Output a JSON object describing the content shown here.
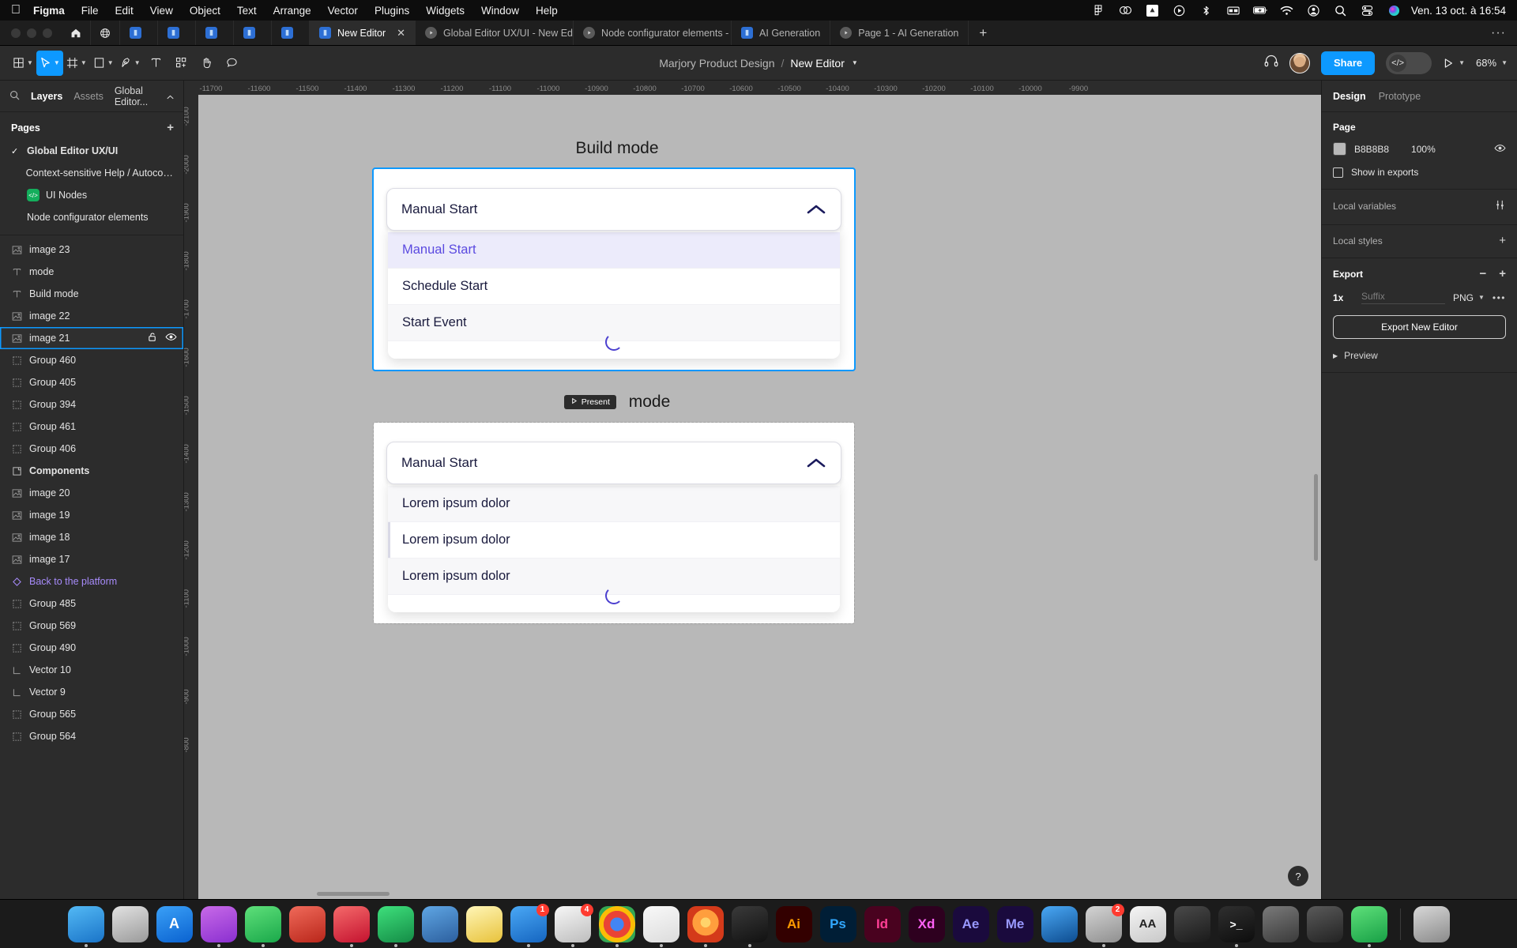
{
  "menubar": {
    "apple_icon": "apple-logo-icon",
    "items": [
      "Figma",
      "File",
      "Edit",
      "View",
      "Object",
      "Text",
      "Arrange",
      "Vector",
      "Plugins",
      "Widgets",
      "Window",
      "Help"
    ],
    "tray_icons": [
      "figma-menu-icon",
      "creative-cloud-icon",
      "dropbox-icon",
      "screen-record-icon",
      "bluetooth-icon",
      "display-icon",
      "battery-charging-icon",
      "wifi-icon",
      "control-center-account-icon",
      "search-icon",
      "control-center-icon",
      "siri-icon"
    ],
    "clock": "Ven. 13 oct. à 16:54"
  },
  "tabbar": {
    "home_icon": "home-icon",
    "globe_icon": "globe-icon",
    "tabs": [
      {
        "label": "",
        "icon": "figma-file-icon",
        "active": false
      },
      {
        "label": "",
        "icon": "figma-file-icon",
        "active": false
      },
      {
        "label": "",
        "icon": "figma-file-icon",
        "active": false
      },
      {
        "label": "",
        "icon": "figma-file-icon",
        "active": false
      },
      {
        "label": "",
        "icon": "figma-file-icon",
        "active": false
      },
      {
        "label": "New Editor",
        "icon": "figma-file-icon",
        "active": true
      },
      {
        "label": "Global Editor UX/UI - New Editor",
        "icon": "present-icon",
        "active": false
      },
      {
        "label": "Node configurator elements - New E",
        "icon": "present-icon",
        "active": false
      },
      {
        "label": "AI Generation",
        "icon": "figma-file-icon",
        "active": false
      },
      {
        "label": "Page 1 - AI Generation",
        "icon": "present-icon",
        "active": false
      }
    ],
    "new_tab_label": "+",
    "overflow_label": "···"
  },
  "toolbar": {
    "tools": [
      {
        "name": "main-menu-tool",
        "icon": "figma-logo-icon",
        "caret": true,
        "active": false
      },
      {
        "name": "move-tool",
        "icon": "cursor-icon",
        "caret": true,
        "active": true
      },
      {
        "name": "frame-tool",
        "icon": "frame-icon",
        "caret": true,
        "active": false
      },
      {
        "name": "shape-tool",
        "icon": "rectangle-icon",
        "caret": true,
        "active": false
      },
      {
        "name": "pen-tool",
        "icon": "pen-icon",
        "caret": true,
        "active": false
      },
      {
        "name": "text-tool",
        "icon": "text-icon",
        "caret": false,
        "active": false
      },
      {
        "name": "resources-tool",
        "icon": "components-plus-icon",
        "caret": false,
        "active": false
      },
      {
        "name": "hand-tool",
        "icon": "hand-icon",
        "caret": false,
        "active": false
      },
      {
        "name": "comment-tool",
        "icon": "comment-icon",
        "caret": false,
        "active": false
      }
    ],
    "project_name": "Marjory Product Design",
    "separator": "/",
    "file_name": "New Editor",
    "headphones_icon": "headphones-icon",
    "avatar_name": "user-avatar",
    "share_label": "Share",
    "dev_mode_icon": "code-icon",
    "present_icon": "play-icon",
    "zoom_level": "68%"
  },
  "left_panel": {
    "search_icon": "search-icon",
    "tabs": [
      {
        "label": "Layers",
        "active": true
      },
      {
        "label": "Assets",
        "active": false
      }
    ],
    "page_selector": "Global Editor...",
    "pages_title": "Pages",
    "add_page_label": "+",
    "pages": [
      {
        "label": "Global Editor UX/UI",
        "checked": true,
        "badge": null
      },
      {
        "label": "Context-sensitive Help / Autocomple...",
        "checked": false,
        "badge": null
      },
      {
        "label": "UI Nodes",
        "checked": false,
        "badge": "code-badge-icon"
      },
      {
        "label": "Node configurator elements",
        "checked": false,
        "badge": null
      }
    ],
    "layers": [
      {
        "label": "image 23",
        "icon": "image-icon",
        "selected": false,
        "bold": false,
        "link": false
      },
      {
        "label": "mode",
        "icon": "text-layer-icon",
        "selected": false,
        "bold": false,
        "link": false
      },
      {
        "label": "Build mode",
        "icon": "text-layer-icon",
        "selected": false,
        "bold": false,
        "link": false
      },
      {
        "label": "image 22",
        "icon": "image-icon",
        "selected": false,
        "bold": false,
        "link": false
      },
      {
        "label": "image 21",
        "icon": "image-icon",
        "selected": true,
        "bold": false,
        "link": false
      },
      {
        "label": "Group 460",
        "icon": "group-icon",
        "selected": false,
        "bold": false,
        "link": false
      },
      {
        "label": "Group 405",
        "icon": "group-icon",
        "selected": false,
        "bold": false,
        "link": false
      },
      {
        "label": "Group 394",
        "icon": "group-icon",
        "selected": false,
        "bold": false,
        "link": false
      },
      {
        "label": "Group 461",
        "icon": "group-icon",
        "selected": false,
        "bold": false,
        "link": false
      },
      {
        "label": "Group 406",
        "icon": "group-icon",
        "selected": false,
        "bold": false,
        "link": false
      },
      {
        "label": "Components",
        "icon": "frame-layer-icon",
        "selected": false,
        "bold": true,
        "link": false
      },
      {
        "label": "image 20",
        "icon": "image-icon",
        "selected": false,
        "bold": false,
        "link": false
      },
      {
        "label": "image 19",
        "icon": "image-icon",
        "selected": false,
        "bold": false,
        "link": false
      },
      {
        "label": "image 18",
        "icon": "image-icon",
        "selected": false,
        "bold": false,
        "link": false
      },
      {
        "label": "image 17",
        "icon": "image-icon",
        "selected": false,
        "bold": false,
        "link": false
      },
      {
        "label": "Back to the platform",
        "icon": "component-icon",
        "selected": false,
        "bold": false,
        "link": true
      },
      {
        "label": "Group 485",
        "icon": "group-icon",
        "selected": false,
        "bold": false,
        "link": false
      },
      {
        "label": "Group 569",
        "icon": "group-icon",
        "selected": false,
        "bold": false,
        "link": false
      },
      {
        "label": "Group 490",
        "icon": "group-icon",
        "selected": false,
        "bold": false,
        "link": false
      },
      {
        "label": "Vector 10",
        "icon": "vector-icon",
        "selected": false,
        "bold": false,
        "link": false
      },
      {
        "label": "Vector 9",
        "icon": "vector-icon",
        "selected": false,
        "bold": false,
        "link": false
      },
      {
        "label": "Group 565",
        "icon": "group-icon",
        "selected": false,
        "bold": false,
        "link": false
      },
      {
        "label": "Group 564",
        "icon": "group-icon",
        "selected": false,
        "bold": false,
        "link": false
      }
    ],
    "selected_row_actions": [
      "unlock-icon",
      "visible-eye-icon"
    ]
  },
  "canvas": {
    "ruler_top_ticks": [
      "-11700",
      "-11600",
      "-11500",
      "-11400",
      "-11300",
      "-11200",
      "-11100",
      "-11000",
      "-10900",
      "-10800",
      "-10700",
      "-10600",
      "-10500",
      "-10400",
      "-10300",
      "-10200",
      "-10100",
      "-10000",
      "-9900"
    ],
    "ruler_left_ticks": [
      "-2100",
      "-2000",
      "-1900",
      "-1800",
      "-1700",
      "-1600",
      "-1500",
      "-1400",
      "-1300",
      "-1200",
      "-1100",
      "-1000",
      "-900",
      "-800"
    ],
    "help_label": "?",
    "cards": [
      {
        "title": "Build mode",
        "present_pill": null,
        "selected": true,
        "selected_value": "Manual Start",
        "chevron_icon": "chevron-up-icon",
        "options": [
          {
            "label": "Manual Start",
            "highlighted": true
          },
          {
            "label": "Schedule Start",
            "highlighted": false
          },
          {
            "label": "Start Event",
            "highlighted": false
          }
        ],
        "spinner": "loading-spinner-icon"
      },
      {
        "title": "mode",
        "present_pill": "Present",
        "present_pill_icon": "play-icon",
        "selected": false,
        "selected_value": "Manual Start",
        "chevron_icon": "chevron-up-icon",
        "options": [
          {
            "label": "Lorem ipsum dolor",
            "highlighted": false
          },
          {
            "label": "Lorem ipsum dolor",
            "highlighted": false
          },
          {
            "label": "Lorem ipsum dolor",
            "highlighted": false
          }
        ],
        "spinner": "loading-spinner-icon"
      }
    ]
  },
  "right_panel": {
    "tabs": [
      {
        "label": "Design",
        "active": true
      },
      {
        "label": "Prototype",
        "active": false
      }
    ],
    "page_section": {
      "title": "Page",
      "color_hex": "B8B8B8",
      "opacity": "100%",
      "eye_icon": "visible-eye-icon",
      "show_in_exports_label": "Show in exports"
    },
    "local_variables": {
      "label": "Local variables",
      "icon": "sliders-icon"
    },
    "local_styles": {
      "label": "Local styles",
      "icon": "plus-icon"
    },
    "export": {
      "title": "Export",
      "minus_label": "−",
      "plus_label": "+",
      "scale": "1x",
      "suffix_placeholder": "Suffix",
      "format": "PNG",
      "more_label": "•••",
      "button_label": "Export New Editor",
      "preview_label": "Preview"
    }
  },
  "dock": {
    "items": [
      {
        "name": "finder",
        "label": "",
        "color1": "#53b9f5",
        "color2": "#1a74c8",
        "running": true,
        "badge": null
      },
      {
        "name": "launchpad",
        "label": "",
        "color1": "#d8d8d8",
        "color2": "#9a9a9a",
        "running": false,
        "badge": null
      },
      {
        "name": "app-store",
        "label": "A",
        "color1": "#3aa0f7",
        "color2": "#0a62d0",
        "running": false,
        "badge": null
      },
      {
        "name": "podcasts",
        "label": "",
        "color1": "#c86ae8",
        "color2": "#8a2fd0",
        "running": true,
        "badge": null
      },
      {
        "name": "whatsapp",
        "label": "",
        "color1": "#5ee07a",
        "color2": "#1aa84a",
        "running": true,
        "badge": null
      },
      {
        "name": "acrobat",
        "label": "",
        "color1": "#f06a5a",
        "color2": "#b9261a",
        "running": false,
        "badge": null
      },
      {
        "name": "opera",
        "label": "",
        "color1": "#f56a6a",
        "color2": "#c4122f",
        "running": true,
        "badge": null
      },
      {
        "name": "spotify",
        "label": "",
        "color1": "#3ee07c",
        "color2": "#148c46",
        "running": true,
        "badge": null
      },
      {
        "name": "keynote",
        "label": "",
        "color1": "#4a90d9",
        "color2": "#2c5f9e",
        "running": false,
        "badge": null
      },
      {
        "name": "notes",
        "label": "",
        "color1": "#fff2a8",
        "color2": "#e8c23a",
        "running": false,
        "badge": null
      },
      {
        "name": "mail",
        "label": "",
        "color1": "#4aa8f5",
        "color2": "#1565c0",
        "running": true,
        "badge": "1"
      },
      {
        "name": "slack",
        "label": "",
        "color1": "#f0f0f0",
        "color2": "#bdbdbd",
        "running": true,
        "badge": "4"
      },
      {
        "name": "chrome",
        "label": "",
        "color1": "#f5f5f5",
        "color2": "#d0d0d0",
        "running": true,
        "badge": null
      },
      {
        "name": "google-drive",
        "label": "",
        "color1": "#f6f6f6",
        "color2": "#d8d8d8",
        "running": true,
        "badge": null
      },
      {
        "name": "firefox",
        "label": "",
        "color1": "#ff9e3d",
        "color2": "#d43a1a",
        "running": true,
        "badge": null
      },
      {
        "name": "figma",
        "label": "",
        "color1": "#2c2c2c",
        "color2": "#111111",
        "running": true,
        "badge": null
      },
      {
        "name": "illustrator",
        "label": "Ai",
        "color1": "#4a2000",
        "color2": "#2b1100",
        "running": false,
        "badge": null
      },
      {
        "name": "photoshop",
        "label": "Ps",
        "color1": "#002244",
        "color2": "#001428",
        "running": false,
        "badge": null
      },
      {
        "name": "indesign",
        "label": "Id",
        "color1": "#49021f",
        "color2": "#2a0010",
        "running": false,
        "badge": null
      },
      {
        "name": "xd",
        "label": "Xd",
        "color1": "#2e001f",
        "color2": "#190010",
        "running": false,
        "badge": null
      },
      {
        "name": "after-effects",
        "label": "Ae",
        "color1": "#1a0a3d",
        "color2": "#0d0520",
        "running": false,
        "badge": null
      },
      {
        "name": "media-encoder",
        "label": "Me",
        "color1": "#1a0a3d",
        "color2": "#0d0520",
        "running": false,
        "badge": null
      },
      {
        "name": "lightroom",
        "label": "",
        "color1": "#4aa8f5",
        "color2": "#0d4c8f",
        "running": false,
        "badge": null
      },
      {
        "name": "preferences",
        "label": "",
        "color1": "#c9c9c9",
        "color2": "#8f8f8f",
        "running": true,
        "badge": "2"
      },
      {
        "name": "font-book",
        "label": "AA",
        "color1": "#f0f0f0",
        "color2": "#c8c8c8",
        "running": false,
        "badge": null
      },
      {
        "name": "calculator",
        "label": "",
        "color1": "#3c3c3c",
        "color2": "#1a1a1a",
        "running": false,
        "badge": null
      },
      {
        "name": "terminal",
        "label": ">_",
        "color1": "#2a2a2a",
        "color2": "#0d0d0d",
        "running": true,
        "badge": null
      },
      {
        "name": "time-machine",
        "label": "",
        "color1": "#6a6a6a",
        "color2": "#3a3a3a",
        "running": false,
        "badge": null
      },
      {
        "name": "quicktime",
        "label": "",
        "color1": "#4a4a4a",
        "color2": "#222222",
        "running": false,
        "badge": null
      },
      {
        "name": "facetime",
        "label": "",
        "color1": "#5ee07a",
        "color2": "#18a046",
        "running": true,
        "badge": null
      },
      {
        "name": "trash",
        "label": "",
        "color1": "#cfcfcf",
        "color2": "#8a8a8a",
        "running": false,
        "badge": null
      }
    ]
  }
}
